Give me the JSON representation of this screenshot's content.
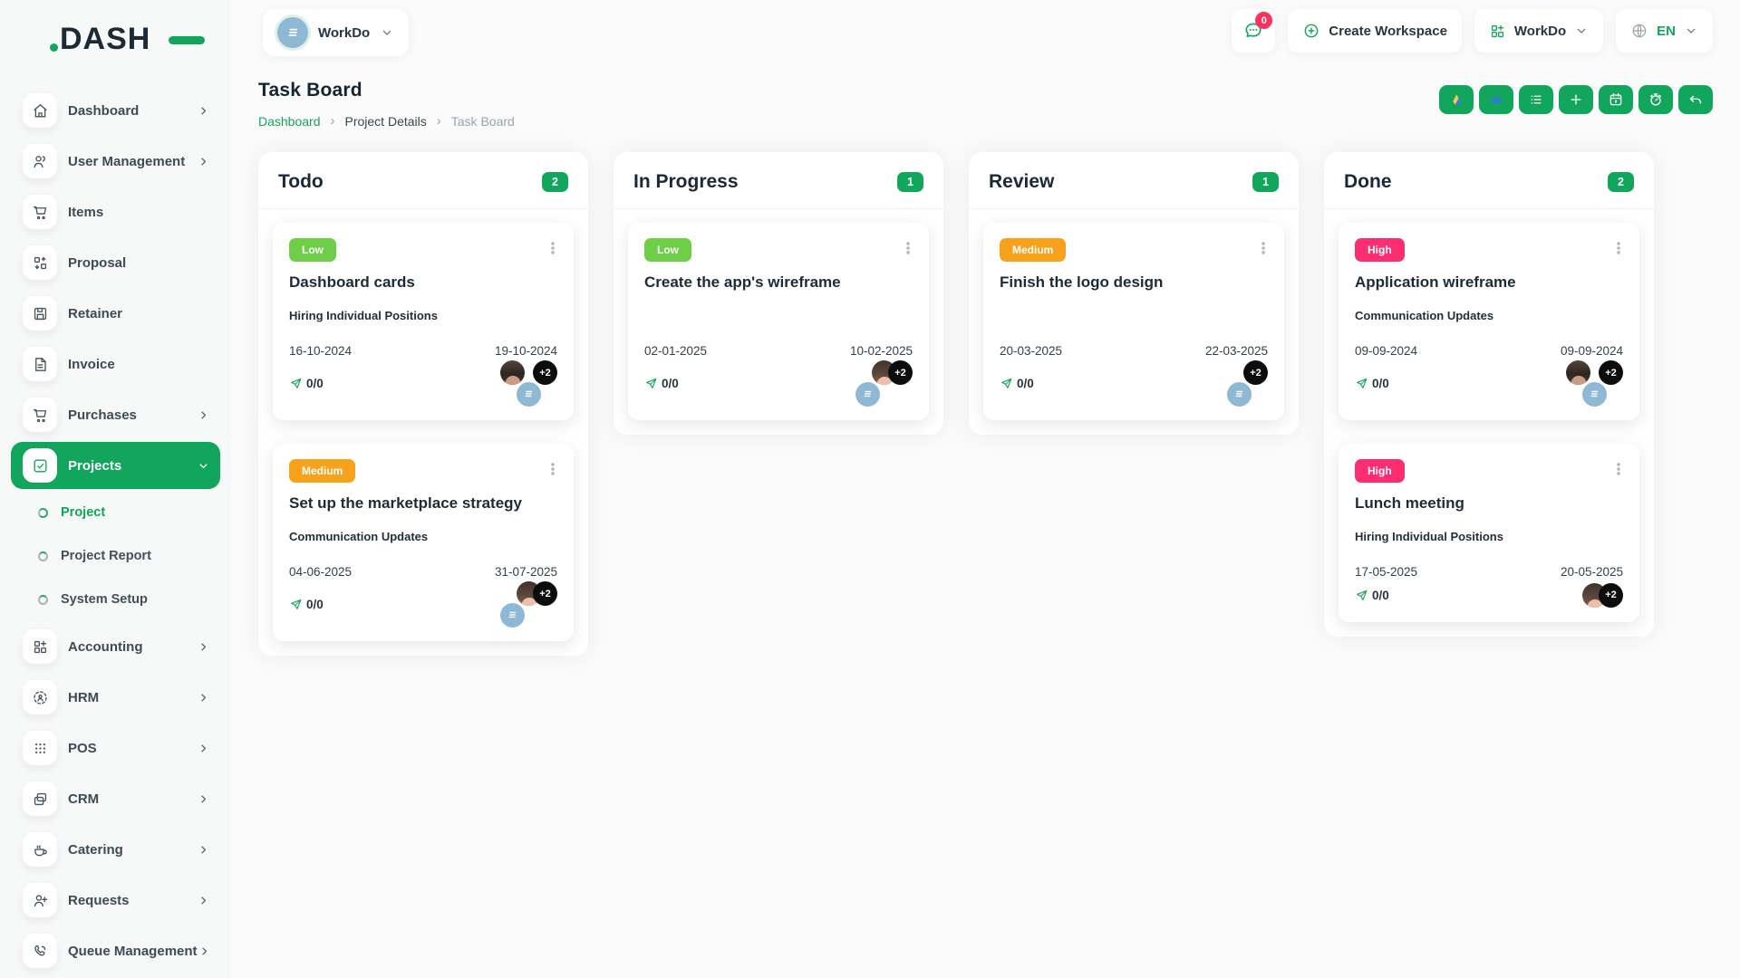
{
  "app": {
    "logo": "DASH"
  },
  "topbar": {
    "workspace_selector": {
      "label": "WorkDo"
    },
    "messages_badge": "0",
    "create_workspace_label": "Create Workspace",
    "workspace_switcher_label": "WorkDo",
    "language_label": "EN"
  },
  "page": {
    "title": "Task Board",
    "breadcrumb": [
      "Dashboard",
      "Project Details",
      "Task Board"
    ]
  },
  "toolbar": {
    "buttons": [
      {
        "name": "google-drive",
        "icon": "gdrive-icon"
      },
      {
        "name": "onedrive",
        "icon": "onedrive-icon"
      },
      {
        "name": "list-view",
        "icon": "list-icon"
      },
      {
        "name": "add-task",
        "icon": "plus-icon"
      },
      {
        "name": "calendar-view",
        "icon": "calendar-icon"
      },
      {
        "name": "timer",
        "icon": "stopwatch-icon"
      },
      {
        "name": "back",
        "icon": "undo-icon"
      }
    ]
  },
  "sidebar": {
    "items": [
      {
        "label": "Dashboard",
        "icon": "home-icon",
        "chevron": true
      },
      {
        "label": "User Management",
        "icon": "users-icon",
        "chevron": true
      },
      {
        "label": "Items",
        "icon": "cart-icon",
        "chevron": false
      },
      {
        "label": "Proposal",
        "icon": "proposal-icon",
        "chevron": false
      },
      {
        "label": "Retainer",
        "icon": "retainer-icon",
        "chevron": false
      },
      {
        "label": "Invoice",
        "icon": "invoice-icon",
        "chevron": false
      },
      {
        "label": "Purchases",
        "icon": "cart-icon",
        "chevron": true
      },
      {
        "label": "Projects",
        "icon": "check-square-icon",
        "chevron": true,
        "active": true,
        "submenu": [
          {
            "label": "Project",
            "active": true
          },
          {
            "label": "Project Report",
            "active": false
          },
          {
            "label": "System Setup",
            "active": false
          }
        ]
      },
      {
        "label": "Accounting",
        "icon": "grid-plus-icon",
        "chevron": true
      },
      {
        "label": "HRM",
        "icon": "hrm-icon",
        "chevron": true
      },
      {
        "label": "POS",
        "icon": "pos-icon",
        "chevron": true
      },
      {
        "label": "CRM",
        "icon": "crm-icon",
        "chevron": true
      },
      {
        "label": "Catering",
        "icon": "catering-icon",
        "chevron": true
      },
      {
        "label": "Requests",
        "icon": "user-plus-icon",
        "chevron": true
      },
      {
        "label": "Queue Management",
        "icon": "phone-icon",
        "chevron": true
      }
    ]
  },
  "board": {
    "columns": [
      {
        "name": "Todo",
        "count": "2",
        "cards": [
          {
            "priority": "Low",
            "title": "Dashboard cards",
            "subtitle": "Hiring Individual Positions",
            "start_date": "16-10-2024",
            "end_date": "19-10-2024",
            "progress": "0/0",
            "avatars": [
              "photo-a",
              "logo"
            ],
            "more_label": "+2"
          },
          {
            "priority": "Medium",
            "title": "Set up the marketplace strategy",
            "subtitle": "Communication Updates",
            "start_date": "04-06-2025",
            "end_date": "31-07-2025",
            "progress": "0/0",
            "avatars": [
              "logo",
              "photo-b"
            ],
            "more_label": "+2"
          }
        ]
      },
      {
        "name": "In Progress",
        "count": "1",
        "cards": [
          {
            "priority": "Low",
            "title": "Create the app's wireframe",
            "subtitle": "",
            "start_date": "02-01-2025",
            "end_date": "10-02-2025",
            "progress": "0/0",
            "avatars": [
              "logo",
              "photo-b"
            ],
            "more_label": "+2"
          }
        ]
      },
      {
        "name": "Review",
        "count": "1",
        "cards": [
          {
            "priority": "Medium",
            "title": "Finish the logo design",
            "subtitle": "",
            "start_date": "20-03-2025",
            "end_date": "22-03-2025",
            "progress": "0/0",
            "avatars": [
              "logo"
            ],
            "more_label": "+2"
          }
        ]
      },
      {
        "name": "Done",
        "count": "2",
        "cards": [
          {
            "priority": "High",
            "title": "Application wireframe",
            "subtitle": "Communication Updates",
            "start_date": "09-09-2024",
            "end_date": "09-09-2024",
            "progress": "0/0",
            "avatars": [
              "photo-a",
              "logo"
            ],
            "more_label": "+2"
          },
          {
            "priority": "High",
            "title": "Lunch meeting",
            "subtitle": "Hiring Individual Positions",
            "start_date": "17-05-2025",
            "end_date": "20-05-2025",
            "progress": "0/0",
            "avatars": [
              "photo-b"
            ],
            "more_label": "+2"
          }
        ]
      }
    ]
  },
  "colors": {
    "accent": "#12A55C",
    "priority": {
      "Low": "#6ECE48",
      "Medium": "#F8A21C",
      "High": "#FB2E72"
    },
    "chat_badge": "#F8335E",
    "avatar_logo_bg": "#8FB8D4",
    "plus_badge": "#0D0D0D"
  }
}
